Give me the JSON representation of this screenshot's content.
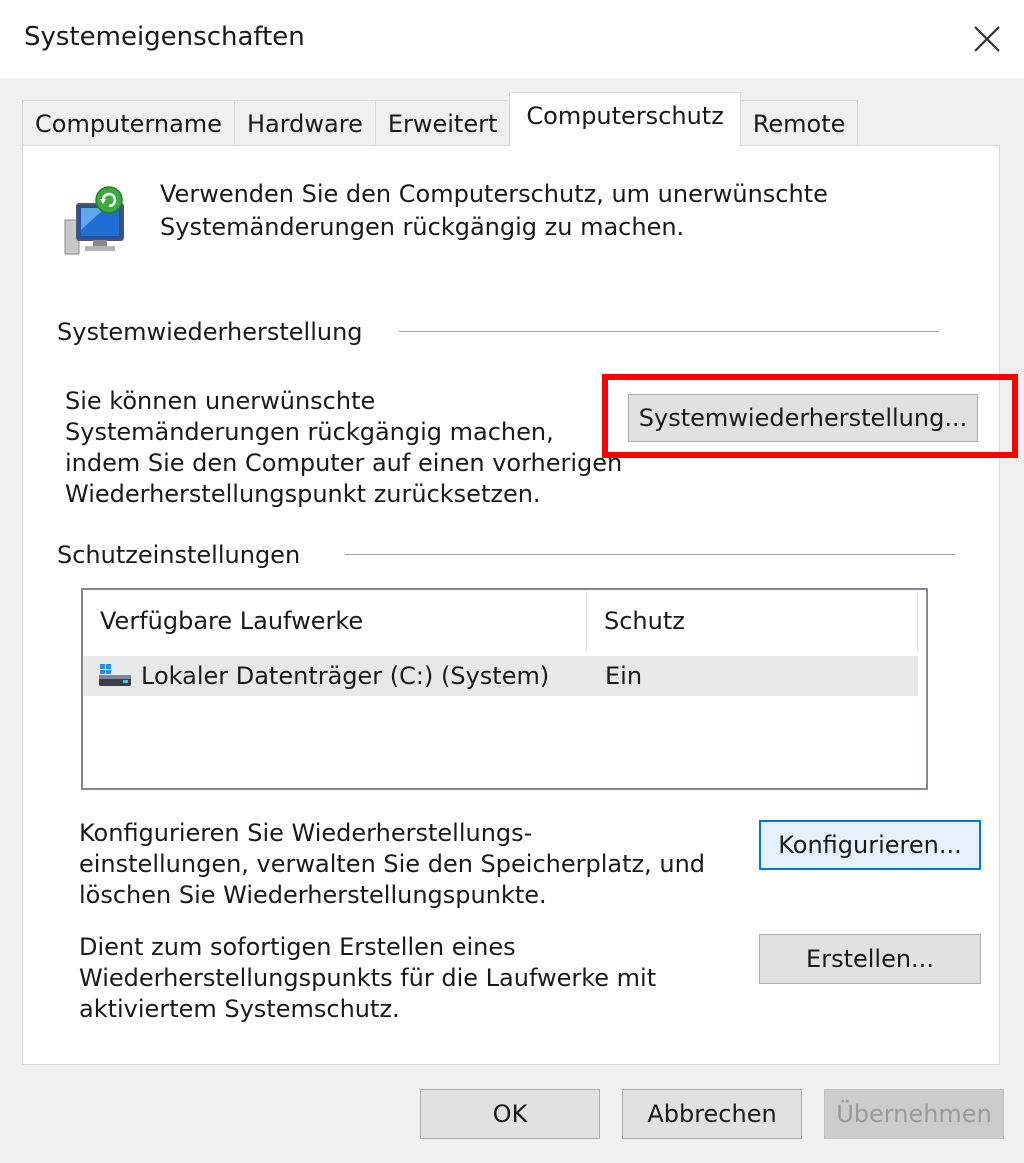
{
  "window": {
    "title": "Systemeigenschaften"
  },
  "tabs": [
    {
      "label": "Computername"
    },
    {
      "label": "Hardware"
    },
    {
      "label": "Erweitert"
    },
    {
      "label": "Computerschutz",
      "active": true
    },
    {
      "label": "Remote"
    }
  ],
  "intro": {
    "icon": "system-protection-icon",
    "text_line1": "Verwenden Sie den Computerschutz, um unerwünschte",
    "text_line2": "Systemänderungen rückgängig zu machen."
  },
  "restore": {
    "group_label": "Systemwiederherstellung",
    "description_lines": [
      "Sie können unerwünschte",
      "Systemänderungen rückgängig machen,",
      "indem Sie den Computer auf einen vorherigen",
      "Wiederherstellungspunkt zurücksetzen."
    ],
    "button_label": "Systemwiederherstellung...",
    "highlight_color": "#ff0000"
  },
  "protection": {
    "group_label": "Schutzeinstellungen",
    "columns": [
      "Verfügbare Laufwerke",
      "Schutz"
    ],
    "rows": [
      {
        "icon": "drive-icon",
        "name": "Lokaler Datenträger (C:) (System)",
        "status": "Ein"
      }
    ]
  },
  "configure": {
    "description_lines": [
      "Konfigurieren Sie Wiederherstellungs-",
      "einstellungen, verwalten Sie den Speicherplatz, und",
      "löschen Sie Wiederherstellungspunkte."
    ],
    "button_label": "Konfigurieren..."
  },
  "create": {
    "description_lines": [
      "Dient zum sofortigen Erstellen eines",
      "Wiederherstellungspunkts für die Laufwerke mit",
      "aktiviertem Systemschutz."
    ],
    "button_label": "Erstellen..."
  },
  "footer": {
    "ok_label": "OK",
    "cancel_label": "Abbrechen",
    "apply_label": "Übernehmen"
  },
  "colors": {
    "accent": "#0078d7",
    "highlight": "#ff0000"
  }
}
